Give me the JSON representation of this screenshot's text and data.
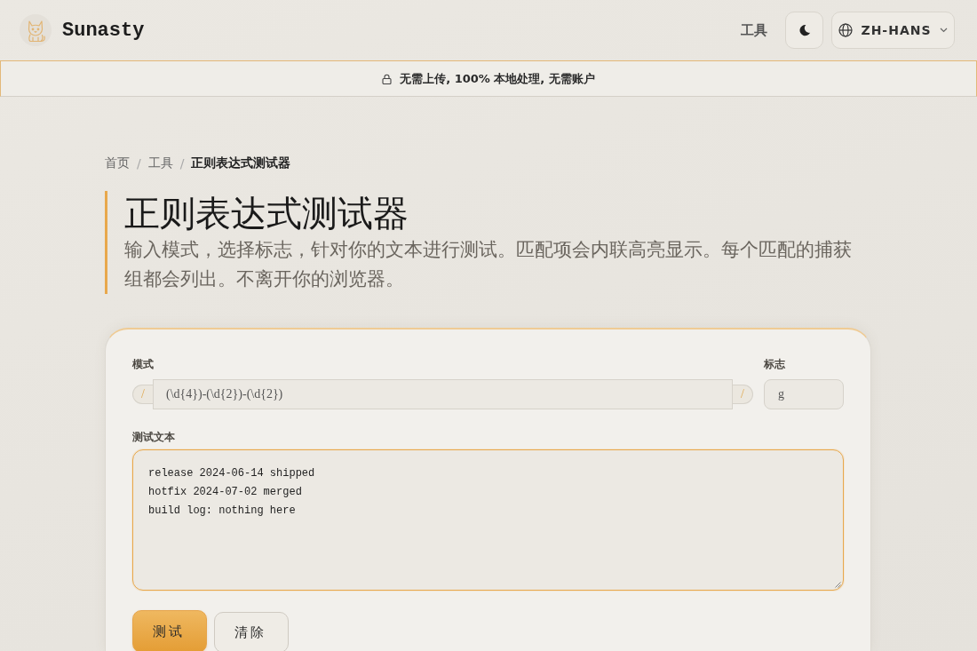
{
  "header": {
    "logo_text": "Sunasty",
    "nav_link": "工具",
    "language": "ZH-HANS"
  },
  "banner": {
    "text": "无需上传, 100% 本地处理, 无需账户"
  },
  "breadcrumb": {
    "items": [
      {
        "label": "首页",
        "current": false
      },
      {
        "label": "工具",
        "current": false
      },
      {
        "label": "正则表达式测试器",
        "current": true
      }
    ],
    "separators": [
      "/",
      "/"
    ]
  },
  "intro": {
    "title": "正则表达式测试器",
    "subtitle": "输入模式，选择标志，针对你的文本进行测试。匹配项会内联高亮显示。每个匹配的捕获组都会列出。不离开你的浏览器。"
  },
  "form": {
    "pattern": {
      "label": "模式",
      "open_delimiter": "/",
      "value": "(\\d{4})-(\\d{2})-(\\d{2})",
      "close_delimiter": "/",
      "focused": false
    },
    "flags": {
      "label": "标志",
      "value": "g",
      "focused": false
    },
    "test_text": {
      "label": "测试文本",
      "value": "release 2024-06-14 shipped\nhotfix 2024-07-02 merged\nbuild log: nothing here",
      "focused": true
    },
    "buttons": [
      {
        "label": "测试",
        "kind": "primary"
      },
      {
        "label": "清除",
        "kind": "secondary"
      }
    ]
  }
}
